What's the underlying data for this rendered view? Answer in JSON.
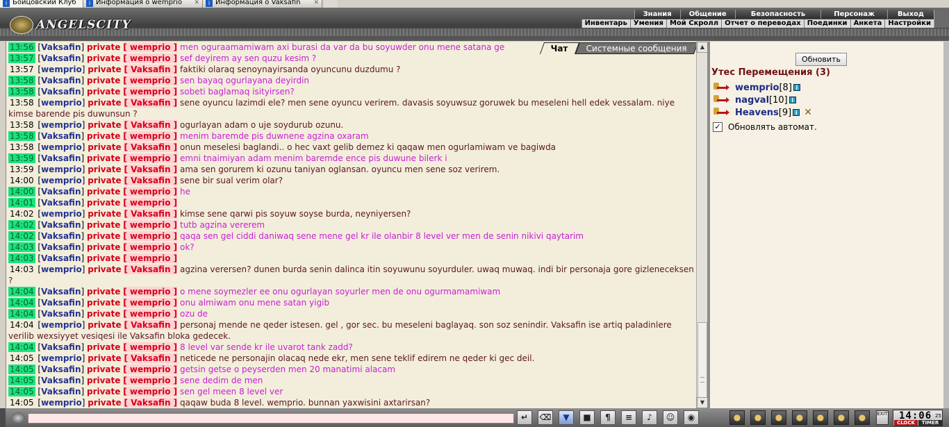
{
  "browser_tabs": [
    {
      "label": "Бойцовский Клуб",
      "active": true
    },
    {
      "label": "Информация о wemprio",
      "active": false
    },
    {
      "label": "Информация о Vaksafin",
      "active": false
    }
  ],
  "header": {
    "logo_text": "ANGELSCITY",
    "menu_top": [
      "Знания",
      "Общение",
      "Безопасность",
      "Персонаж",
      "Выход"
    ],
    "menu_bottom": [
      "Инвентарь",
      "Умения",
      "Мой Скролл",
      "Отчет о переводах",
      "Поединки",
      "Анкета",
      "Настройки"
    ]
  },
  "chat_tabs": {
    "chat": "Чат",
    "system": "Системные сообщения"
  },
  "messages": [
    {
      "time": "13:56",
      "hl": true,
      "nick": "Vaksafin",
      "target": "wemprio",
      "text": "men oguraamamiwam axi burasi da var da bu soyuwder onu mene satana ge",
      "pink": true
    },
    {
      "time": "13:57",
      "hl": true,
      "nick": "Vaksafin",
      "target": "wemprio",
      "text": "sef deyirem ay sen quzu kesim ?",
      "pink": true
    },
    {
      "time": "13:57",
      "hl": false,
      "nick": "wemprio",
      "target": "Vaksafin",
      "text": "faktiki olaraq senoynayirsanda oyuncunu duzdumu ?",
      "pink": false
    },
    {
      "time": "13:58",
      "hl": true,
      "nick": "Vaksafin",
      "target": "wemprio",
      "text": "sen bayaq ogurlayana deyirdin",
      "pink": true
    },
    {
      "time": "13:58",
      "hl": true,
      "nick": "Vaksafin",
      "target": "wemprio",
      "text": "sobeti baglamaq isityirsen?",
      "pink": true
    },
    {
      "time": "13:58",
      "hl": false,
      "nick": "wemprio",
      "target": "Vaksafin",
      "text": "sene oyuncu lazimdi ele? men sene oyuncu verirem. davasis soyuwsuz goruwek bu meseleni hell edek vessalam. niye kimse barende pis duwunsun ?",
      "pink": false
    },
    {
      "time": "13:58",
      "hl": false,
      "nick": "wemprio",
      "target": "Vaksafin",
      "text": "ogurlayan adam o uje soydurub ozunu.",
      "pink": false
    },
    {
      "time": "13:58",
      "hl": true,
      "nick": "Vaksafin",
      "target": "wemprio",
      "text": "menim baremde pis duwnene agzina oxaram",
      "pink": true
    },
    {
      "time": "13:58",
      "hl": false,
      "nick": "wemprio",
      "target": "Vaksafin",
      "text": "onun meselesi baglandi.. o hec vaxt gelib demez ki qaqaw men ogurlamiwam ve bagiwda",
      "pink": false
    },
    {
      "time": "13:59",
      "hl": true,
      "nick": "Vaksafin",
      "target": "wemprio",
      "text": "emni tnaimiyan adam menim baremde ence pis duwune bilerk i",
      "pink": true
    },
    {
      "time": "13:59",
      "hl": false,
      "nick": "wemprio",
      "target": "Vaksafin",
      "text": "ama sen gorurem ki ozunu taniyan oglansan. oyuncu men sene soz verirem.",
      "pink": false
    },
    {
      "time": "14:00",
      "hl": false,
      "nick": "wemprio",
      "target": "Vaksafin",
      "text": "sene bir sual verim olar?",
      "pink": false
    },
    {
      "time": "14:00",
      "hl": true,
      "nick": "Vaksafin",
      "target": "wemprio",
      "text": "he",
      "pink": true
    },
    {
      "time": "14:01",
      "hl": true,
      "nick": "Vaksafin",
      "target": "wemprio",
      "text": "",
      "pink": true
    },
    {
      "time": "14:02",
      "hl": false,
      "nick": "wemprio",
      "target": "Vaksafin",
      "text": "kimse sene qarwi pis soyuw soyse burda, neyniyersen?",
      "pink": false
    },
    {
      "time": "14:02",
      "hl": true,
      "nick": "Vaksafin",
      "target": "wemprio",
      "text": "tutb agzina vererem",
      "pink": true
    },
    {
      "time": "14:02",
      "hl": true,
      "nick": "Vaksafin",
      "target": "wemprio",
      "text": "qaqa sen gel ciddi daniwaq sene mene gel kr ile olanbir 8 level ver men de senin nikivi qaytarim",
      "pink": true
    },
    {
      "time": "14:03",
      "hl": true,
      "nick": "Vaksafin",
      "target": "wemprio",
      "text": "ok?",
      "pink": true
    },
    {
      "time": "14:03",
      "hl": true,
      "nick": "Vaksafin",
      "target": "wemprio",
      "text": "",
      "pink": true
    },
    {
      "time": "14:03",
      "hl": false,
      "nick": "wemprio",
      "target": "Vaksafin",
      "text": "agzina verersen? dunen burda senin dalinca itin soyuwunu soyurduler. uwaq muwaq. indi bir personaja gore gizleneceksen ?",
      "pink": false
    },
    {
      "time": "14:04",
      "hl": true,
      "nick": "Vaksafin",
      "target": "wemprio",
      "text": "o mene soymezler ee onu ogurlayan soyurler men de onu ogurmamamiwam",
      "pink": true
    },
    {
      "time": "14:04",
      "hl": true,
      "nick": "Vaksafin",
      "target": "wemprio",
      "text": "onu almiwam onu mene satan yigib",
      "pink": true
    },
    {
      "time": "14:04",
      "hl": true,
      "nick": "Vaksafin",
      "target": "wemprio",
      "text": "ozu de",
      "pink": true
    },
    {
      "time": "14:04",
      "hl": false,
      "nick": "wemprio",
      "target": "Vaksafin",
      "text": "personaj mende ne qeder istesen. gel , gor sec. bu meseleni baglayaq. son soz senindir. Vaksafin ise artiq paladinlere verilib wexsiyyet vesiqesi ile Vaksafin bloka gedecek.",
      "pink": false
    },
    {
      "time": "14:04",
      "hl": true,
      "nick": "Vaksafin",
      "target": "wemprio",
      "text": "8 level var sende kr ile uvarot tank zadd?",
      "pink": true
    },
    {
      "time": "14:05",
      "hl": false,
      "nick": "wemprio",
      "target": "Vaksafin",
      "text": "neticede ne personajin olacaq nede ekr, men sene teklif edirem ne qeder ki gec deil.",
      "pink": false
    },
    {
      "time": "14:05",
      "hl": true,
      "nick": "Vaksafin",
      "target": "wemprio",
      "text": "getsin getse o peyserden men 20 manatimi alacam",
      "pink": true
    },
    {
      "time": "14:05",
      "hl": true,
      "nick": "Vaksafin",
      "target": "wemprio",
      "text": "sene dedim de men",
      "pink": true
    },
    {
      "time": "14:05",
      "hl": true,
      "nick": "Vaksafin",
      "target": "wemprio",
      "text": "sen gel meen 8 level ver",
      "pink": true
    },
    {
      "time": "14:05",
      "hl": false,
      "nick": "wemprio",
      "target": "Vaksafin",
      "text": "qaqaw buda 8 level. wemprio. bunnan yaxwisini axtarirsan?",
      "pink": false
    }
  ],
  "private_label": "private",
  "panel": {
    "refresh_label": "Обновить",
    "location_title": "Утес Перемещения (3)",
    "players": [
      {
        "name": "wemprio",
        "level": "[8]",
        "attack": false
      },
      {
        "name": "nagval",
        "level": "[10]",
        "attack": false
      },
      {
        "name": "Heavens",
        "level": "[9]",
        "attack": true
      }
    ],
    "auto_refresh_label": "Обновлять автомат.",
    "auto_refresh_checked": true
  },
  "bottom": {
    "chat_input_value": "",
    "tools": [
      "↵",
      "⌫",
      "▼",
      "■",
      "¶",
      "≡",
      "♪",
      "☺",
      "◉"
    ],
    "tools2": [
      "●",
      "●",
      "●",
      "●",
      "●",
      "●",
      "●"
    ],
    "exit_label": "EXIT",
    "clock": {
      "time": "14:06",
      "seconds": "25",
      "clock_label": "CLOCK",
      "timer_label": "TIMER"
    }
  }
}
